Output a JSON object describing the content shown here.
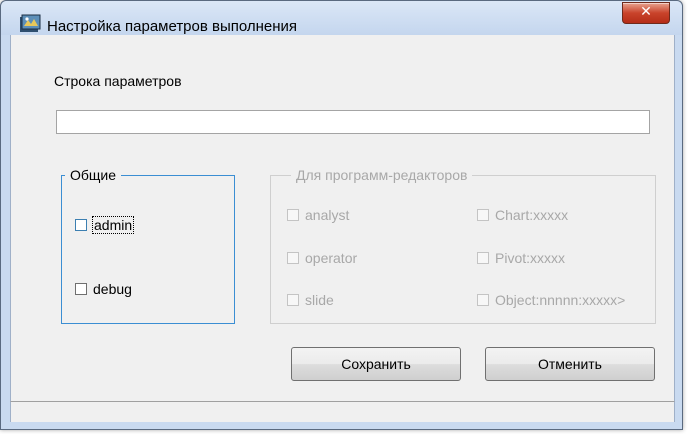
{
  "window": {
    "title": "Настройка параметров выполнения",
    "close_glyph": "✕",
    "app_icon": "app-icon"
  },
  "params": {
    "label": "Строка параметров",
    "value": ""
  },
  "common_group": {
    "legend": "Общие",
    "items": [
      {
        "label": "admin",
        "checked": false
      },
      {
        "label": "debug",
        "checked": false
      }
    ]
  },
  "editors_group": {
    "legend": "Для программ-редакторов",
    "enabled": false,
    "items": [
      {
        "label": "analyst",
        "checked": false
      },
      {
        "label": "operator",
        "checked": false
      },
      {
        "label": "slide",
        "checked": false
      },
      {
        "label": "Chart:xxxxx",
        "checked": false
      },
      {
        "label": "Pivot:xxxxx",
        "checked": false
      },
      {
        "label": "Object:nnnnn:xxxxx>",
        "checked": false
      }
    ]
  },
  "buttons": {
    "save": "Сохранить",
    "cancel": "Отменить"
  },
  "status": {
    "text": ""
  }
}
